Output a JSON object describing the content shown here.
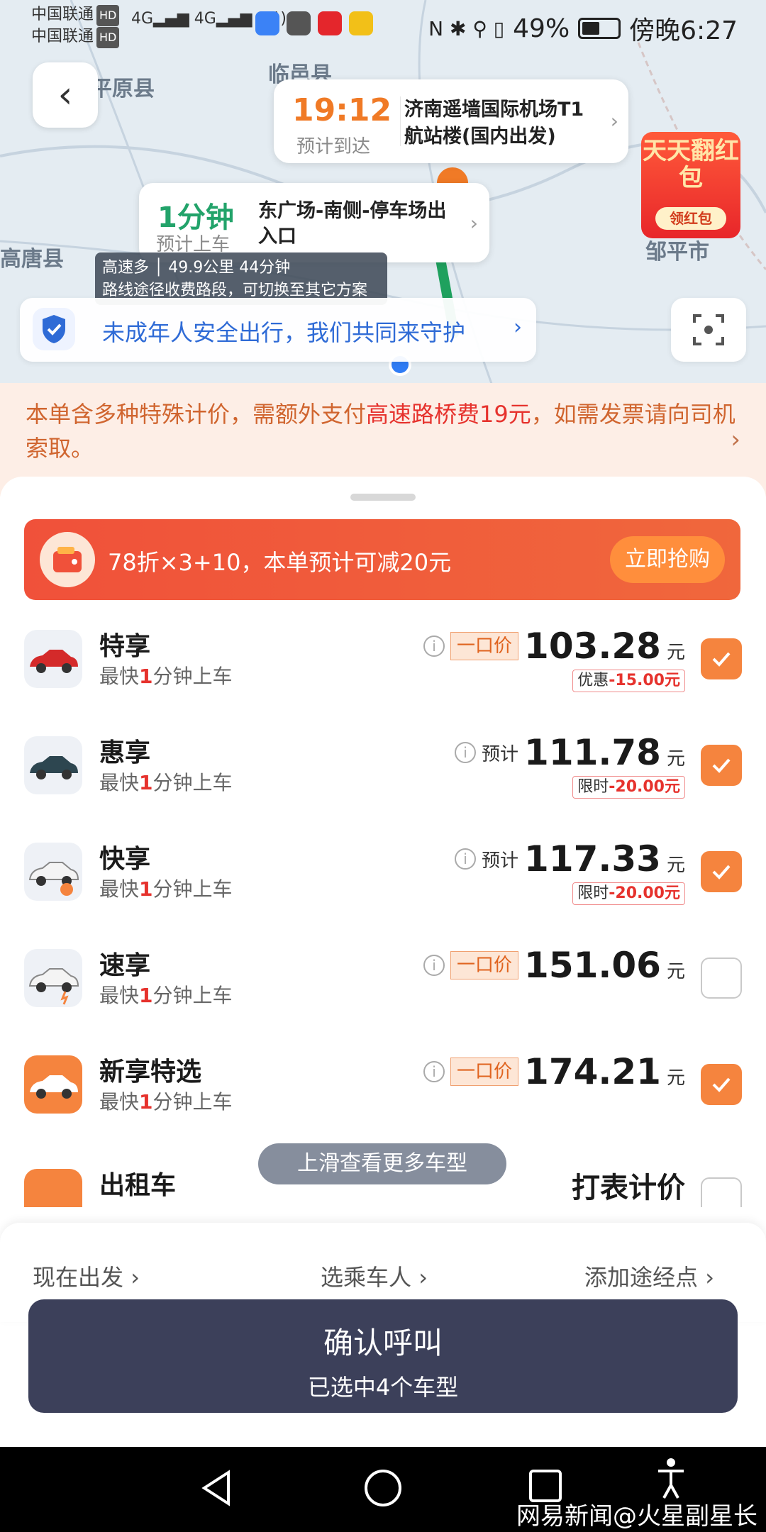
{
  "status": {
    "carrier1": "中国联通",
    "carrier2": "中国联通",
    "hd": "HD",
    "net": "4G",
    "battery": "49%",
    "time": "傍晚6:27"
  },
  "map": {
    "labels": [
      "平原县",
      "临邑县",
      "高唐县",
      "邹平市"
    ],
    "arrive": {
      "time": "19:12",
      "sub": "预计到达",
      "dest": "济南遥墙国际机场T1航站楼(国内出发)"
    },
    "pickup": {
      "time": "1分钟",
      "sub": "预计上车",
      "dest": "东广场-南侧-停车场出入口"
    },
    "route": {
      "line1": "高速多 │ 49.9公里 44分钟",
      "line2": "路线途径收费路段，可切换至其它方案"
    },
    "promo": {
      "title": "天天翻红包",
      "btn": "领红包"
    },
    "safety": "未成年人安全出行，我们共同来守护"
  },
  "fee_notice": {
    "pre": "本单含多种特殊计价，需额外支付",
    "hl": "高速路桥费19元",
    "post": "，如需发票请向司机索取。"
  },
  "coupon": {
    "text": "78折×3+10，本单预计可减20元",
    "btn": "立即抢购"
  },
  "cars": [
    {
      "name": "特享",
      "eta_pre": "最快",
      "eta_num": "1",
      "eta_post": "分钟上车",
      "tag": "一口价",
      "price": "103.28",
      "unit": "元",
      "disc_label": "优惠",
      "disc_amt": "-15.00元",
      "checked": true
    },
    {
      "name": "惠享",
      "eta_pre": "最快",
      "eta_num": "1",
      "eta_post": "分钟上车",
      "tag": "预计",
      "price": "111.78",
      "unit": "元",
      "disc_label": "限时",
      "disc_amt": "-20.00元",
      "checked": true
    },
    {
      "name": "快享",
      "eta_pre": "最快",
      "eta_num": "1",
      "eta_post": "分钟上车",
      "tag": "预计",
      "price": "117.33",
      "unit": "元",
      "disc_label": "限时",
      "disc_amt": "-20.00元",
      "checked": true
    },
    {
      "name": "速享",
      "eta_pre": "最快",
      "eta_num": "1",
      "eta_post": "分钟上车",
      "tag": "一口价",
      "price": "151.06",
      "unit": "元",
      "disc_label": "",
      "disc_amt": "",
      "checked": false
    },
    {
      "name": "新享特选",
      "eta_pre": "最快",
      "eta_num": "1",
      "eta_post": "分钟上车",
      "tag": "一口价",
      "price": "174.21",
      "unit": "元",
      "disc_label": "",
      "disc_amt": "",
      "checked": true
    },
    {
      "name": "出租车",
      "eta_pre": "",
      "eta_num": "",
      "eta_post": "",
      "tag": "",
      "price": "打表计价",
      "unit": "",
      "disc_label": "",
      "disc_amt": "",
      "checked": false
    }
  ],
  "more_hint": "上滑查看更多车型",
  "options": {
    "depart": "现在出发",
    "rider": "选乘车人",
    "stop": "添加途经点"
  },
  "confirm": {
    "title": "确认呼叫",
    "sub": "已选中4个车型"
  },
  "watermark": "网易新闻@火星副星长",
  "colors": {
    "accent": "#f5843e",
    "confirm_bg": "#3c405a",
    "safety_blue": "#2f6bd6",
    "price_red": "#e6322d"
  }
}
